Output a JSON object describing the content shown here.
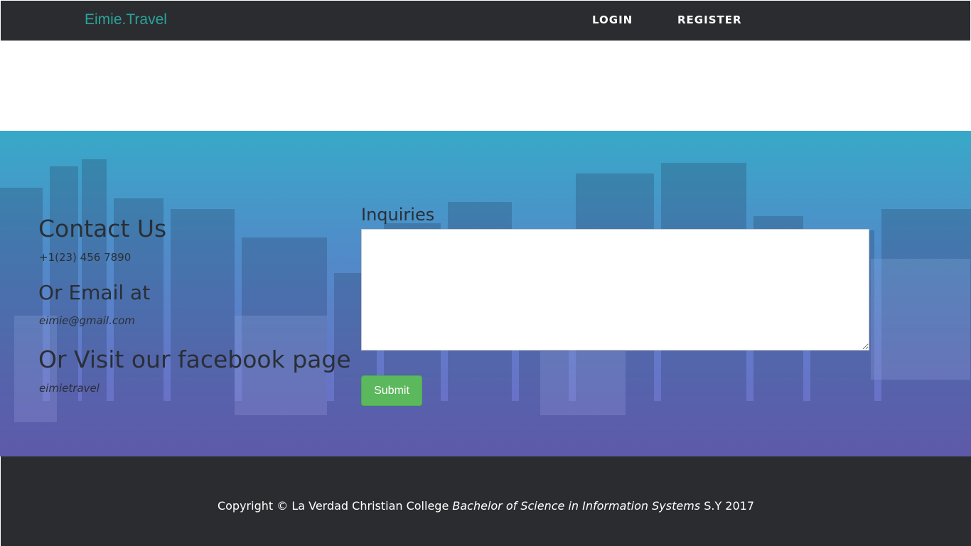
{
  "navbar": {
    "brand": "Eimie.Travel",
    "login_label": "LOGIN",
    "register_label": "REGISTER"
  },
  "contact": {
    "title": "Contact Us",
    "phone": "+1(23) 456 7890",
    "email_title": "Or Email at",
    "email": "eimie@gmail.com",
    "facebook_title": "Or Visit our facebook page",
    "facebook": "eimietravel"
  },
  "inquiry": {
    "label": "Inquiries",
    "value": "",
    "submit_label": "Submit"
  },
  "footer": {
    "prefix": "Copyright © La Verdad Christian College ",
    "course": "Bachelor of Science in Information Systems",
    "suffix": " S.Y 2017"
  },
  "colors": {
    "navbar_bg": "#2b2c2f",
    "brand": "#2aa39b",
    "gradient_top": "#38a9c8",
    "gradient_bottom": "#7168c6",
    "submit": "#5cb85c"
  }
}
